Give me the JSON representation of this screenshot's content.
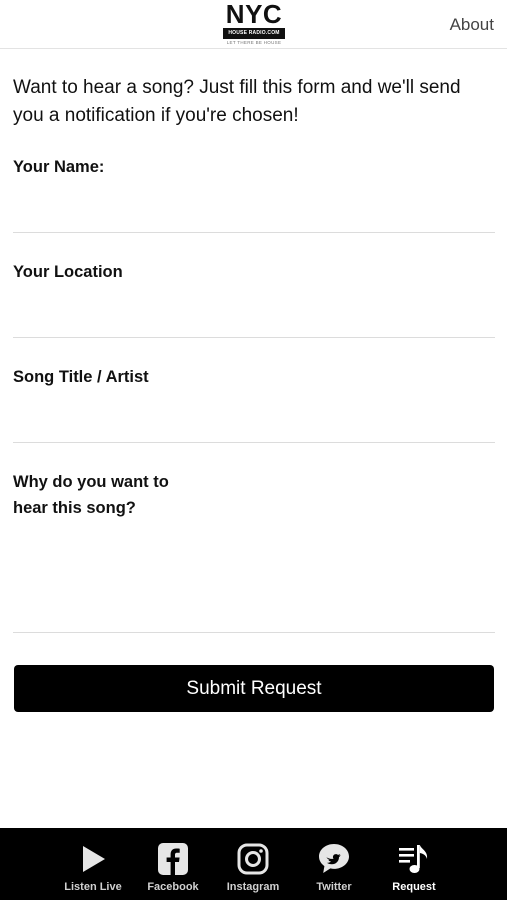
{
  "header": {
    "logo": {
      "main": "NYC",
      "bar": "HOUSE RADIO.COM",
      "tagline": "LET THERE BE HOUSE"
    },
    "about_label": "About"
  },
  "form": {
    "intro": "Want to hear a song? Just fill this form and we'll send you a notification if you're chosen!",
    "fields": [
      {
        "label": "Your Name:",
        "value": "",
        "placeholder": ""
      },
      {
        "label": "Your Location",
        "value": "",
        "placeholder": ""
      },
      {
        "label": "Song Title / Artist",
        "value": "",
        "placeholder": ""
      },
      {
        "label": "Why do you want to hear this song?",
        "value": "",
        "placeholder": ""
      }
    ],
    "submit_label": "Submit Request"
  },
  "tabbar": {
    "active": "Request",
    "tabs": [
      {
        "label": "Listen Live",
        "icon": "play-icon"
      },
      {
        "label": "Facebook",
        "icon": "facebook-icon"
      },
      {
        "label": "Instagram",
        "icon": "instagram-icon"
      },
      {
        "label": "Twitter",
        "icon": "twitter-bird-icon"
      },
      {
        "label": "Request",
        "icon": "music-list-icon"
      }
    ]
  },
  "colors": {
    "background": "#ffffff",
    "text": "#111111",
    "button": "#000000",
    "tabbar": "#000000",
    "divider": "#dcdcdc"
  }
}
